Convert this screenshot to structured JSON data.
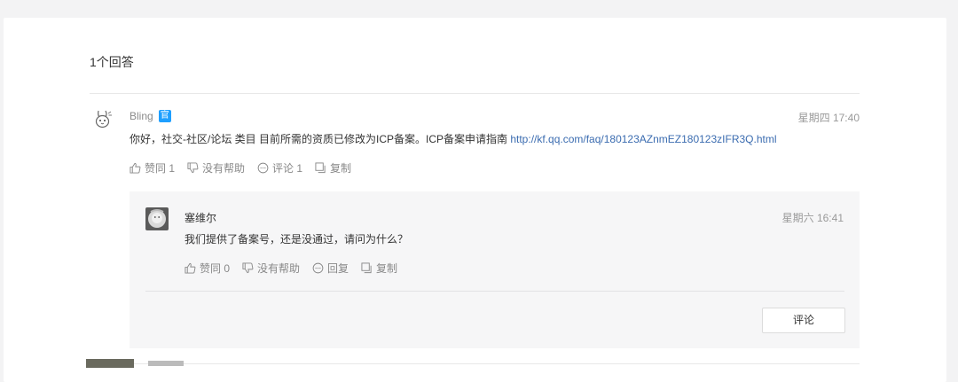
{
  "answers_header": {
    "count_label": "1个回答"
  },
  "answer": {
    "author": "Bling",
    "badge": "官",
    "time": "星期四 17:40",
    "text": "你好，社交-社区/论坛 类目 目前所需的资质已修改为ICP备案。ICP备案申请指南 ",
    "link": "http://kf.qq.com/faq/180123AZnmEZ180123zIFR3Q.html",
    "actions": {
      "agree": "赞同 1",
      "unhelpful": "没有帮助",
      "comment": "评论 1",
      "copy": "复制"
    }
  },
  "reply": {
    "author": "塞维尔",
    "time": "星期六 16:41",
    "text": "我们提供了备案号，还是没通过，请问为什么？",
    "actions": {
      "agree": "赞同 0",
      "unhelpful": "没有帮助",
      "reply": "回复",
      "copy": "复制"
    },
    "comment_button": "评论"
  },
  "colors": {
    "link": "#3b6cb0",
    "badge": "#1e9fff",
    "reply_bg": "#f6f6f7"
  },
  "icons": [
    "thumbs-up-icon",
    "thumbs-down-icon",
    "comment-bubble-icon",
    "copy-icon",
    "official-badge-icon"
  ]
}
